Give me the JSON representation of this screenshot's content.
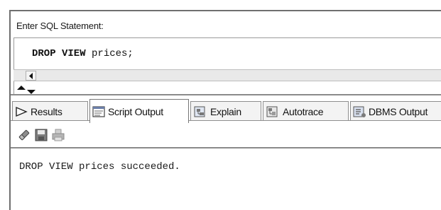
{
  "editor": {
    "label": "Enter SQL Statement:",
    "keyword": "DROP VIEW",
    "rest": " prices;"
  },
  "tabs": [
    {
      "label": "Results",
      "icon": "play-triangle-icon"
    },
    {
      "label": "Script Output",
      "icon": "script-output-icon",
      "active": true
    },
    {
      "label": "Explain",
      "icon": "explain-plan-icon"
    },
    {
      "label": "Autotrace",
      "icon": "autotrace-icon"
    },
    {
      "label": "DBMS Output",
      "icon": "dbms-output-icon"
    }
  ],
  "toolbar": {
    "icons": [
      "eraser-icon",
      "save-icon",
      "print-icon"
    ]
  },
  "output": {
    "text": "DROP VIEW prices succeeded."
  },
  "colors": {
    "border": "#8e8e8e",
    "tab_bg": "#f3f3f3",
    "active_tab_bg": "#ffffff"
  }
}
